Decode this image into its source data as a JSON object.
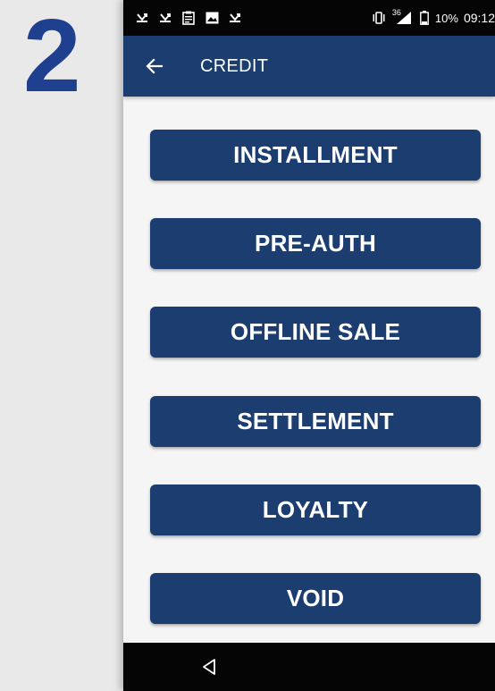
{
  "step": {
    "number": "2"
  },
  "status_bar": {
    "left_icons": [
      "missed-call-icon",
      "missed-call-icon",
      "clipboard-icon",
      "image-icon",
      "missed-call-icon"
    ],
    "signal_label": "36",
    "battery_percent": "10%",
    "time": "09:12"
  },
  "app_bar": {
    "title": "CREDIT",
    "back_icon": "arrow-left-icon"
  },
  "menu": {
    "items": [
      {
        "label": "INSTALLMENT"
      },
      {
        "label": "PRE-AUTH"
      },
      {
        "label": "OFFLINE SALE"
      },
      {
        "label": "SETTLEMENT"
      },
      {
        "label": "LOYALTY"
      },
      {
        "label": "VOID"
      }
    ]
  },
  "nav_bar": {
    "back_icon": "triangle-back-icon"
  },
  "colors": {
    "primary": "#1b3d6f",
    "step_number": "#1f3f8f",
    "background": "#f5f5f5",
    "status_bar": "#050505"
  }
}
